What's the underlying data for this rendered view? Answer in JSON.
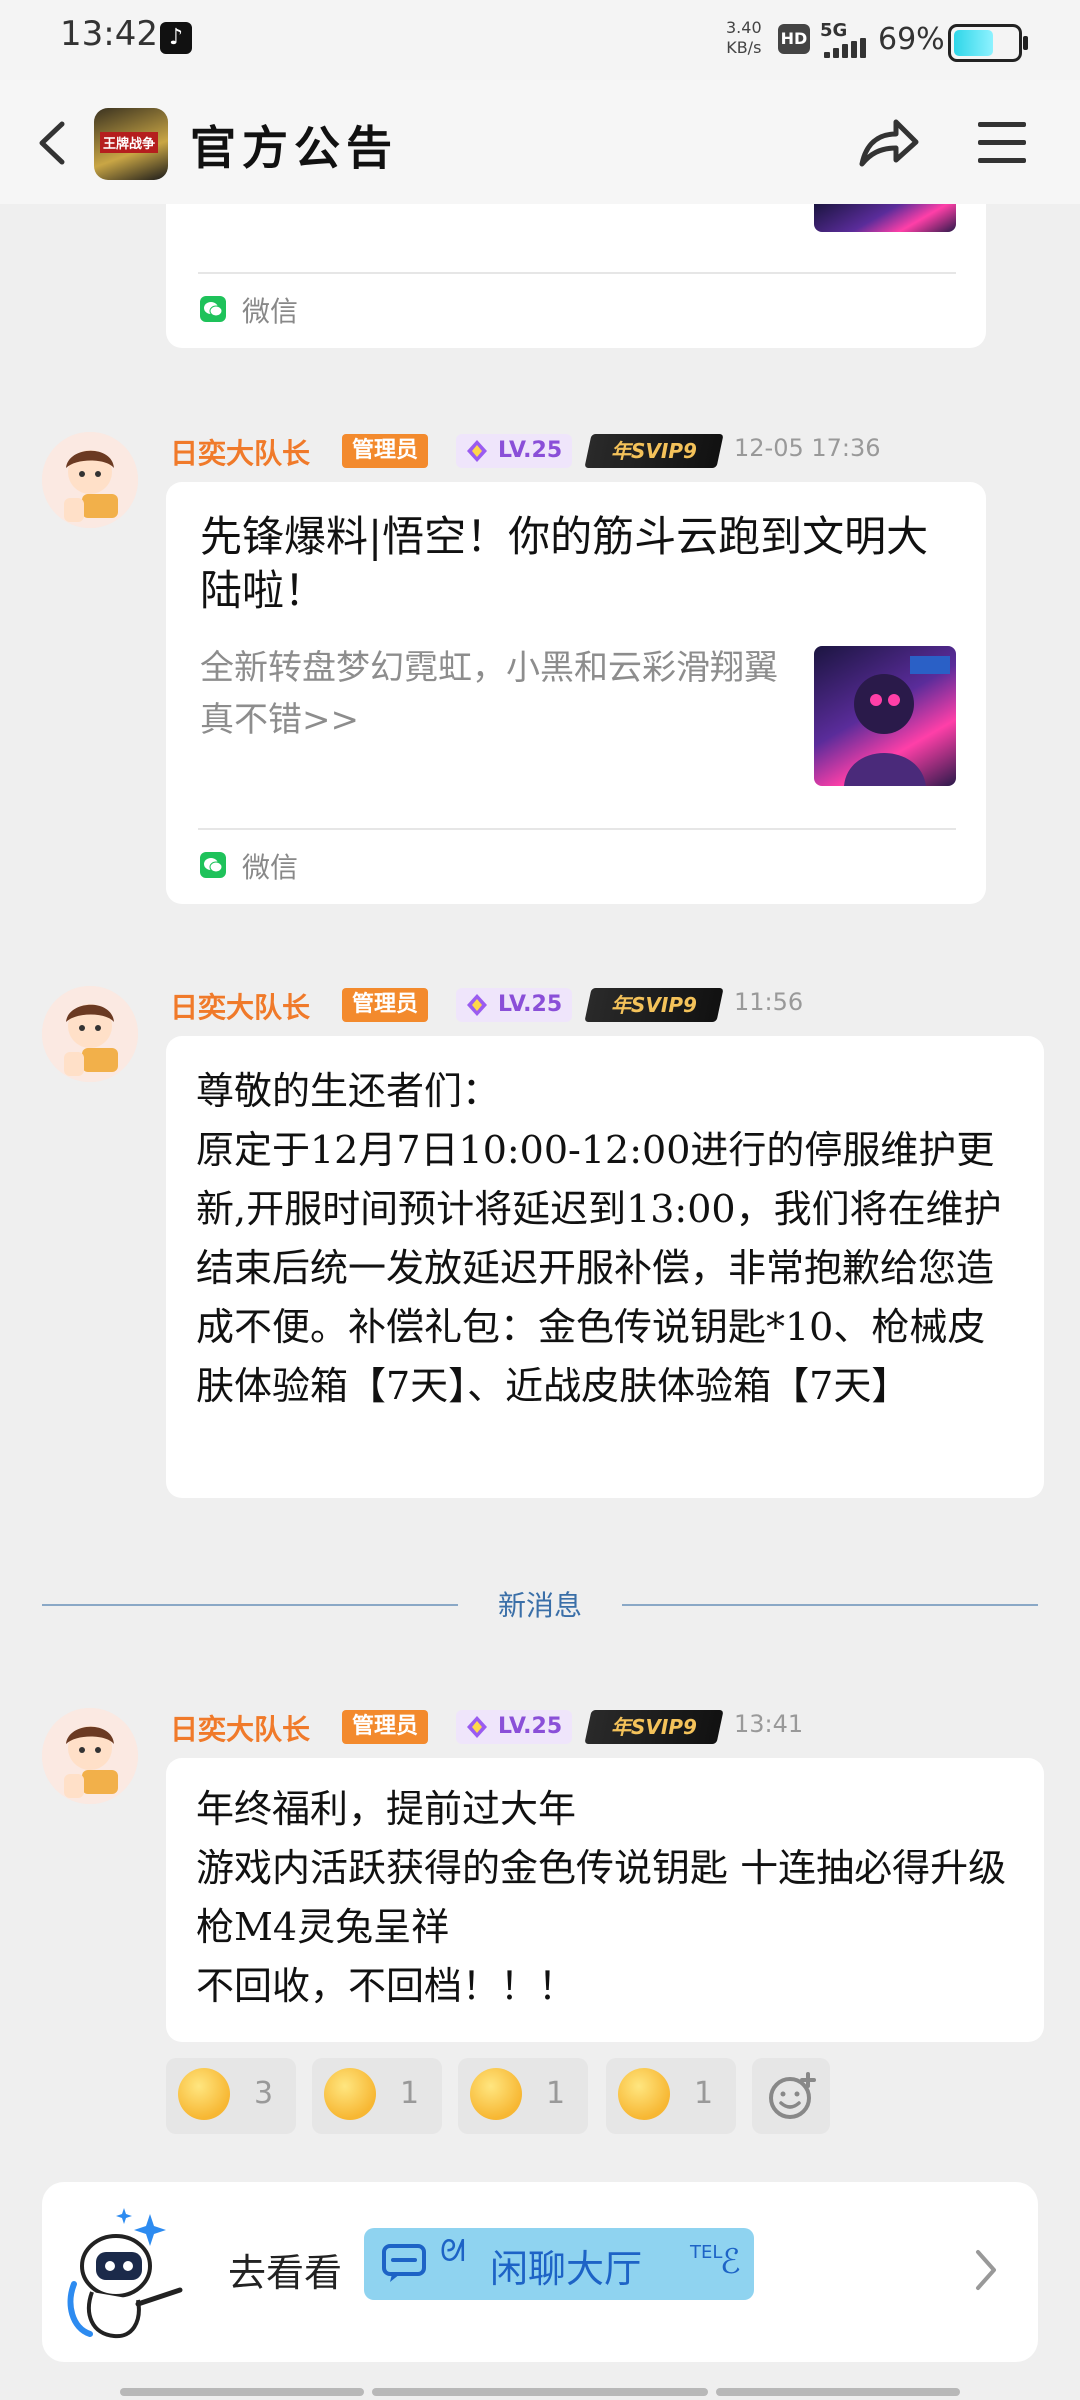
{
  "status_bar": {
    "time": "13:42",
    "net_speed_value": "3.40",
    "net_speed_unit": "KB/s",
    "hd": "HD",
    "signal": "5G",
    "battery": "69%",
    "battery_level": 0.69
  },
  "header": {
    "title": "官方公告",
    "app_icon_text": "王牌战争"
  },
  "posts": [
    {
      "source_label": "微信"
    },
    {
      "author": "日奕大队长",
      "role": "管理员",
      "level": "LV.25",
      "vip": "年SVIP9",
      "time": "12-05 17:36",
      "title": "先锋爆料|悟空！你的筋斗云跑到文明大陆啦！",
      "desc": "全新转盘梦幻霓虹，小黑和云彩滑翔翼真不错>>",
      "source_label": "微信"
    },
    {
      "author": "日奕大队长",
      "role": "管理员",
      "level": "LV.25",
      "vip": "年SVIP9",
      "time": "11:56",
      "body": "尊敬的生还者们：\n原定于12月7日10:00-12:00进行的停服维护更新,开服时间预计将延迟到13:00，我们将在维护结束后统一发放延迟开服补偿，非常抱歉给您造成不便。补偿礼包：金色传说钥匙*10、枪械皮肤体验箱【7天】、近战皮肤体验箱【7天】"
    },
    {
      "author": "日奕大队长",
      "role": "管理员",
      "level": "LV.25",
      "vip": "年SVIP9",
      "time": "13:41",
      "body": "年终福利，提前过大年\n游戏内活跃获得的金色传说钥匙 十连抽必得升级枪M4灵兔呈祥\n不回收，不回档！！！"
    }
  ],
  "divider": {
    "label": "新消息"
  },
  "reactions": [
    {
      "icon": "shush-emoji-icon",
      "count": "3"
    },
    {
      "icon": "kiss-emoji-icon",
      "count": "1"
    },
    {
      "icon": "smirk-emoji-icon",
      "count": "1"
    },
    {
      "icon": "blush-emoji-icon",
      "count": "1"
    }
  ],
  "bottom_card": {
    "goto": "去看看",
    "lobby": "闲聊大厅",
    "tel": "TEL"
  },
  "colors": {
    "author": "#f07a2a",
    "admin_badge": "#f38a2d",
    "level_badge_text": "#8a4fd8",
    "wechat": "#1ec25a",
    "new_message": "#3a6fa8",
    "lobby_bg": "#8fd3f0"
  }
}
